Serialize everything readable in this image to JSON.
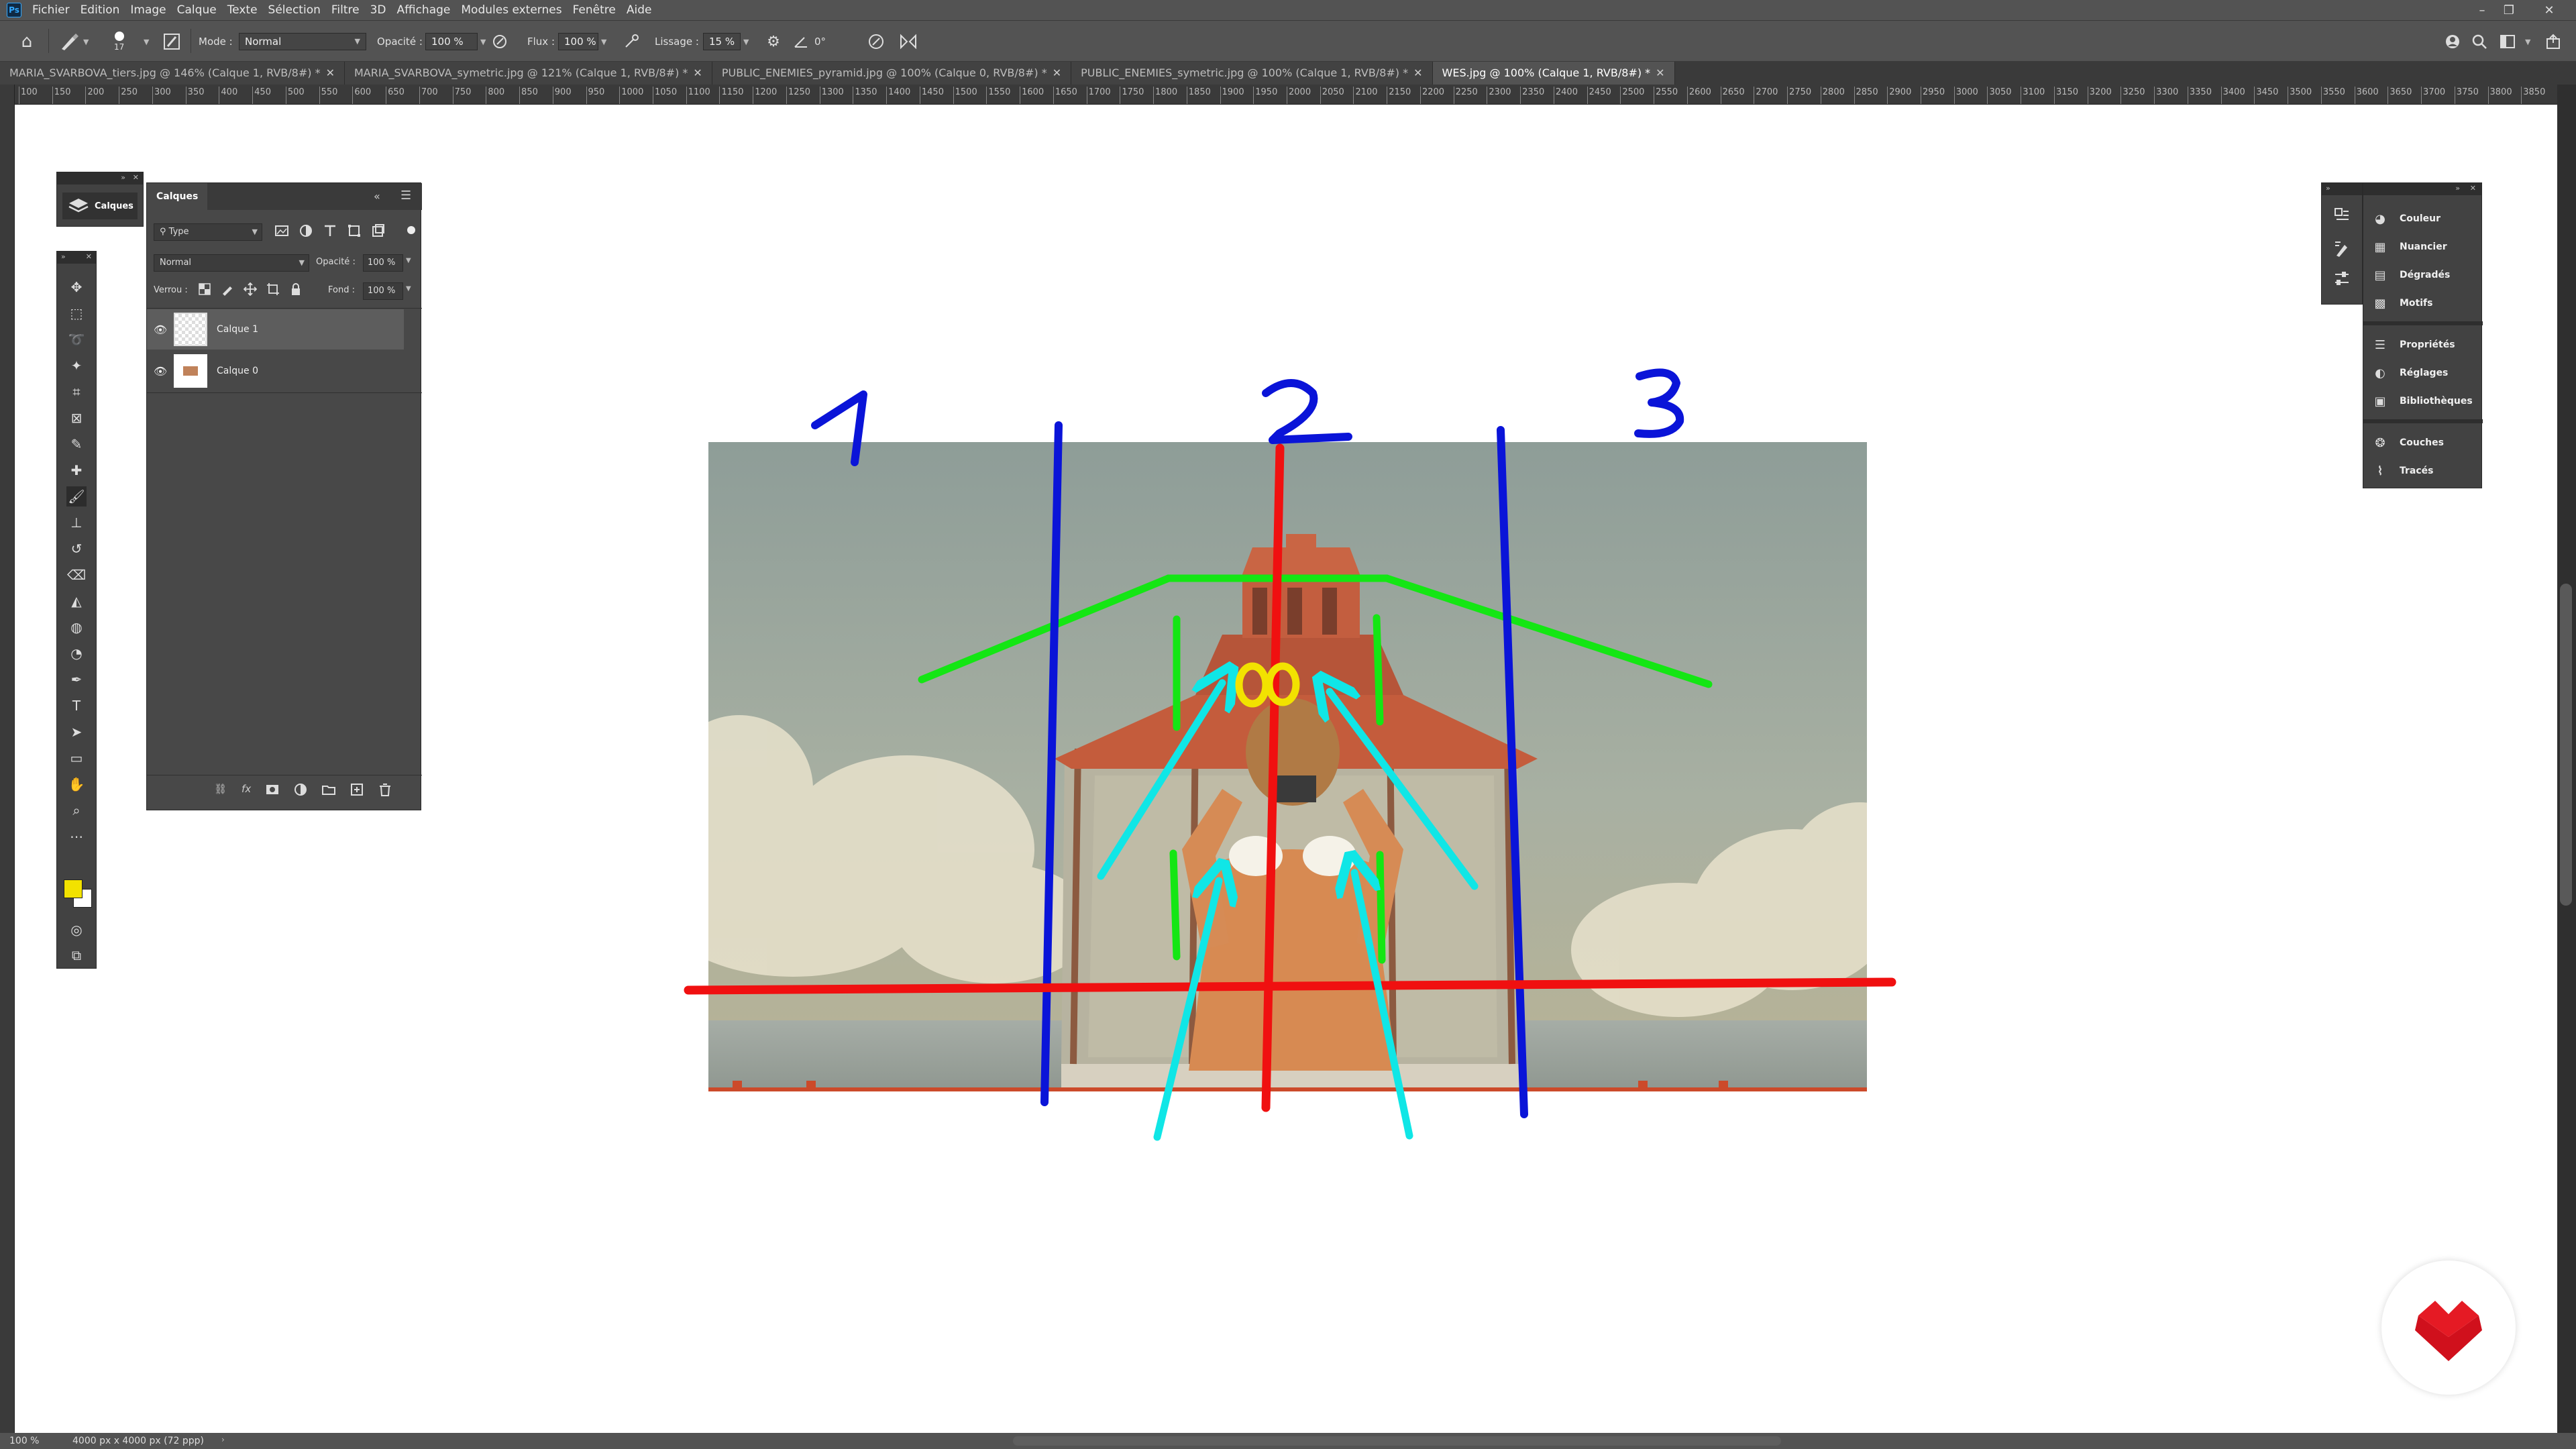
{
  "menu": {
    "app_logo": "Ps",
    "items": [
      "Fichier",
      "Edition",
      "Image",
      "Calque",
      "Texte",
      "Sélection",
      "Filtre",
      "3D",
      "Affichage",
      "Modules externes",
      "Fenêtre",
      "Aide"
    ],
    "window_controls": [
      "–",
      "❐",
      "✕"
    ]
  },
  "options": {
    "brush_size": "17",
    "mode_label": "Mode :",
    "mode_value": "Normal",
    "opacity_label": "Opacité :",
    "opacity_value": "100 %",
    "flow_label": "Flux :",
    "flow_value": "100 %",
    "smoothing_label": "Lissage :",
    "smoothing_value": "15 %",
    "angle_value": "0°"
  },
  "tabs": [
    {
      "label": "MARIA_SVARBOVA_tiers.jpg @ 146% (Calque 1, RVB/8#) *",
      "active": false
    },
    {
      "label": "MARIA_SVARBOVA_symetric.jpg @ 121% (Calque 1, RVB/8#) *",
      "active": false
    },
    {
      "label": "PUBLIC_ENEMIES_pyramid.jpg @ 100% (Calque 0, RVB/8#) *",
      "active": false
    },
    {
      "label": "PUBLIC_ENEMIES_symetric.jpg @ 100% (Calque 1, RVB/8#) *",
      "active": false
    },
    {
      "label": "WES.jpg @ 100% (Calque 1, RVB/8#) *",
      "active": true
    }
  ],
  "ruler_labels": [
    "100",
    "150",
    "200",
    "250",
    "300",
    "350",
    "400",
    "450",
    "500",
    "550",
    "600",
    "650",
    "700",
    "750",
    "800",
    "850",
    "900",
    "950",
    "1000",
    "1050",
    "1100",
    "1150",
    "1200",
    "1250",
    "1300",
    "1350",
    "1400",
    "1450",
    "1500",
    "1550",
    "1600",
    "1650",
    "1700",
    "1750",
    "1800",
    "1850",
    "1900",
    "1950",
    "2000",
    "2050",
    "2100",
    "2150",
    "2200",
    "2250",
    "2300",
    "2350",
    "2400",
    "2450",
    "2500",
    "2550",
    "2600",
    "2650",
    "2700",
    "2750",
    "2800",
    "2850",
    "2900",
    "2950",
    "3000",
    "3050",
    "3100",
    "3150",
    "3200",
    "3250",
    "3300",
    "3350",
    "3400",
    "3450",
    "3500",
    "3550",
    "3600",
    "3650",
    "3700",
    "3750",
    "3800",
    "3850"
  ],
  "collapsed_panel": {
    "label": "Calques"
  },
  "layers_panel": {
    "tab_label": "Calques",
    "filter_value": "Type",
    "blend_mode": "Normal",
    "opacity_label": "Opacité :",
    "opacity_value": "100 %",
    "lock_label": "Verrou :",
    "fill_label": "Fond :",
    "fill_value": "100 %",
    "layers": [
      {
        "name": "Calque 1",
        "selected": true
      },
      {
        "name": "Calque 0",
        "selected": false
      }
    ]
  },
  "right_panel": {
    "group1": [
      "Couleur",
      "Nuancier",
      "Dégradés",
      "Motifs"
    ],
    "group2": [
      "Propriétés",
      "Réglages",
      "Bibliothèques"
    ],
    "group3": [
      "Couches",
      "Tracés"
    ]
  },
  "annotations": {
    "thirds": [
      "1",
      "2",
      "3"
    ]
  },
  "status": {
    "zoom": "100 %",
    "doc_info": "4000 px x 4000 px (72 ppp)"
  },
  "colors": {
    "accent_blue": "#0a14d8",
    "guide_red": "#f01010",
    "guide_green": "#14e614",
    "arrow_cyan": "#10e6e6",
    "binoculars_yellow": "#f2e200",
    "foreground_color": "#f2e200",
    "logo_red": "#d0101c"
  }
}
